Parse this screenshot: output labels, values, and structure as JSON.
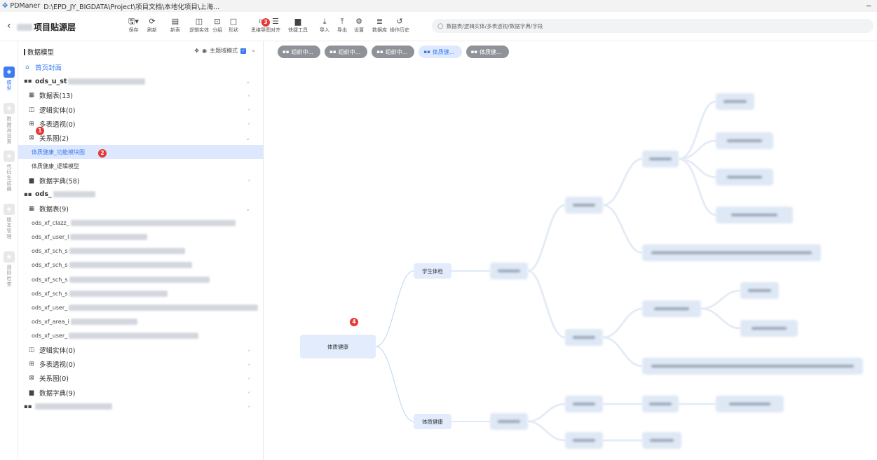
{
  "window": {
    "app_name": "PDManer",
    "path": "D:\\EPD_JY_BIGDATA\\Project\\项目文档\\本地化项目\\上海...",
    "minimize": "‒"
  },
  "header": {
    "back": "‹",
    "project_suffix": "项目贴源层",
    "tools": [
      {
        "icon": "save-icon",
        "glyph": "🖫▾",
        "label": "保存"
      },
      {
        "icon": "refresh-icon",
        "glyph": "⟳",
        "label": "刷新"
      },
      {
        "icon": "new-table-icon",
        "glyph": "▤",
        "label": "新表"
      },
      {
        "icon": "logic-entity-icon",
        "glyph": "◫",
        "label": "逻辑实体"
      },
      {
        "icon": "group-icon",
        "glyph": "⊡",
        "label": "分组"
      },
      {
        "icon": "shape-icon",
        "glyph": "□",
        "label": "形状"
      },
      {
        "icon": "mindmap-icon",
        "glyph": "⌗",
        "label": "思维导图"
      },
      {
        "icon": "align-icon",
        "glyph": "☰",
        "label": "对齐"
      },
      {
        "icon": "toolbox-icon",
        "glyph": "▆",
        "label": "快捷工具"
      },
      {
        "icon": "import-icon",
        "glyph": "⤓",
        "label": "导入"
      },
      {
        "icon": "export-icon",
        "glyph": "⤒",
        "label": "导出"
      },
      {
        "icon": "settings-icon",
        "glyph": "⚙",
        "label": "设置"
      },
      {
        "icon": "database-icon",
        "glyph": "≣",
        "label": "数据库"
      },
      {
        "icon": "history-icon",
        "glyph": "↺",
        "label": "操作历史"
      }
    ],
    "search_placeholder": "数据表/逻辑实体/多表透视/数据字典/字段"
  },
  "markers": [
    "1",
    "2",
    "3",
    "4"
  ],
  "rail": [
    {
      "icon": "model-icon",
      "label": "模型",
      "active": true
    },
    {
      "icon": "database-config-icon",
      "label": "数据源设置",
      "active": false
    },
    {
      "icon": "codegen-icon",
      "label": "代码生成器",
      "active": false
    },
    {
      "icon": "version-icon",
      "label": "版本管理",
      "active": false
    },
    {
      "icon": "rules-icon",
      "label": "规则检查",
      "active": false
    }
  ],
  "sidebar": {
    "title": "数据模型",
    "mode_label": "主题域模式",
    "collapse": "«",
    "home": "首页封面",
    "group1": {
      "prefix": "ods_u_st",
      "tables": "数据表(13)",
      "entities": "逻辑实体(0)",
      "views": "多表透视(0)",
      "diagrams": "关系图(2)",
      "diagram_items": [
        "体质健康_功能模块图",
        "体质健康_逻辑模型"
      ],
      "dicts": "数据字典(58)"
    },
    "group2": {
      "prefix": "ods_",
      "tables": "数据表(9)",
      "table_items": [
        "ods_xf_clazz_",
        "ods_xf_user_l",
        "ods_xf_sch_s",
        "ods_xf_sch_s",
        "ods_xf_sch_s",
        "ods_xf_sch_s",
        "ods_xf_user_",
        "ods_xf_area_i",
        "ods_xf_user_"
      ],
      "entities": "逻辑实体(0)",
      "views": "多表透视(0)",
      "diagrams": "关系图(0)",
      "dicts": "数据字典(9)"
    }
  },
  "tabs": [
    {
      "label": "组织中...",
      "active": false
    },
    {
      "label": "组织中...",
      "active": false
    },
    {
      "label": "组织中...",
      "active": false
    },
    {
      "label": "体质健...",
      "active": true
    },
    {
      "label": "体质健...",
      "active": false
    }
  ],
  "mindmap": {
    "root": "体质健康",
    "branch_a": "学生体检",
    "branch_b": "体质健康"
  }
}
